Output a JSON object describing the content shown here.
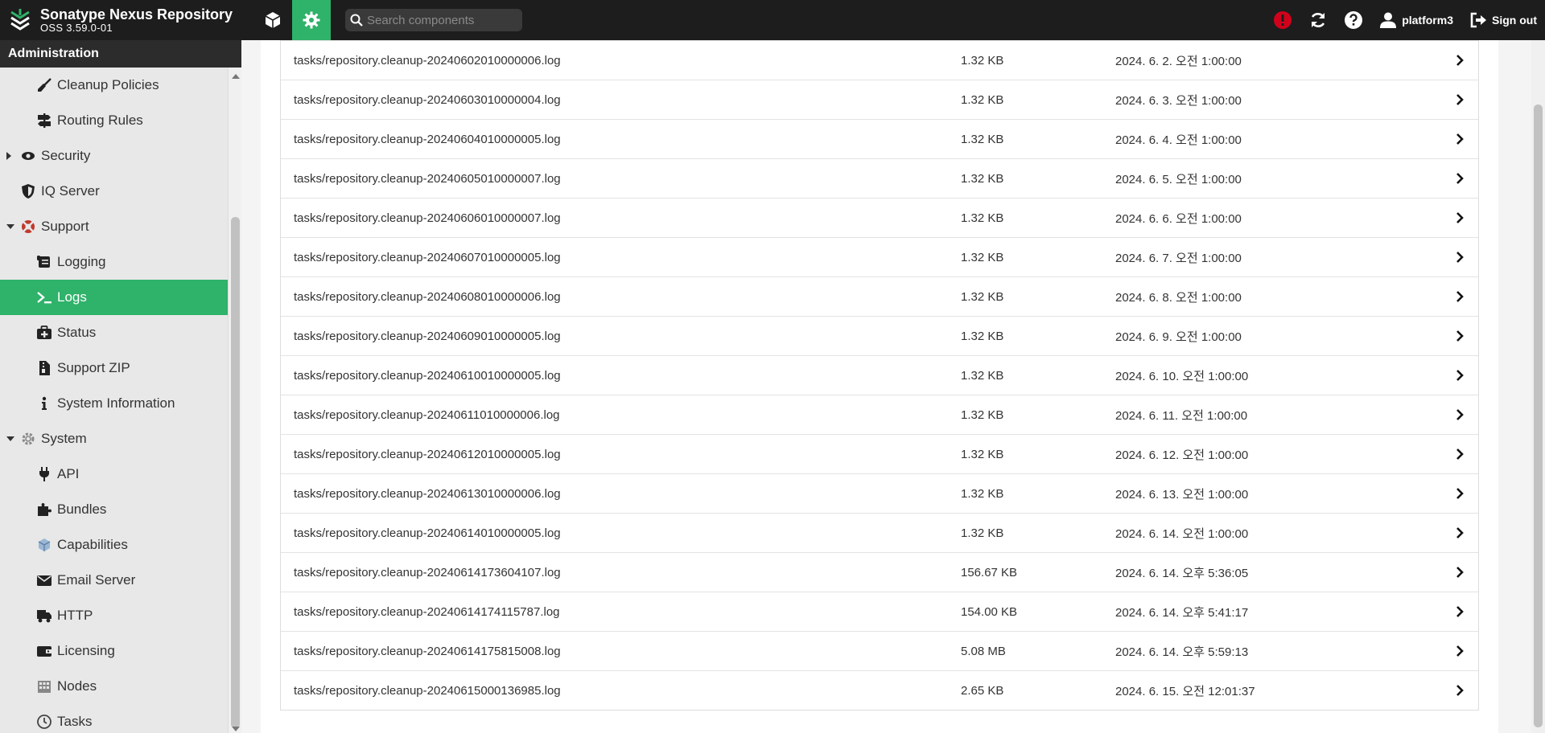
{
  "app": {
    "name": "Sonatype Nexus Repository",
    "version": "OSS 3.59.0-01"
  },
  "header": {
    "search_placeholder": "Search components",
    "user_label": "platform3",
    "signout_label": "Sign out"
  },
  "sidebar": {
    "title": "Administration",
    "items": [
      {
        "label": "Cleanup Policies",
        "icon": "broom-icon",
        "level": 2
      },
      {
        "label": "Routing Rules",
        "icon": "signpost-icon",
        "level": 2
      },
      {
        "label": "Security",
        "icon": "eye-icon",
        "level": 1,
        "caret": "right"
      },
      {
        "label": "IQ Server",
        "icon": "shield-icon",
        "level": 1
      },
      {
        "label": "Support",
        "icon": "lifebuoy-icon",
        "level": 1,
        "caret": "down"
      },
      {
        "label": "Logging",
        "icon": "scroll-icon",
        "level": 2
      },
      {
        "label": "Logs",
        "icon": "terminal-icon",
        "level": 2,
        "selected": true
      },
      {
        "label": "Status",
        "icon": "medkit-icon",
        "level": 2
      },
      {
        "label": "Support ZIP",
        "icon": "zip-file-icon",
        "level": 2
      },
      {
        "label": "System Information",
        "icon": "info-icon",
        "level": 2
      },
      {
        "label": "System",
        "icon": "gears-icon",
        "level": 1,
        "caret": "down"
      },
      {
        "label": "API",
        "icon": "plug-icon",
        "level": 2
      },
      {
        "label": "Bundles",
        "icon": "puzzle-icon",
        "level": 2
      },
      {
        "label": "Capabilities",
        "icon": "cube-icon",
        "level": 2
      },
      {
        "label": "Email Server",
        "icon": "envelope-icon",
        "level": 2
      },
      {
        "label": "HTTP",
        "icon": "truck-icon",
        "level": 2
      },
      {
        "label": "Licensing",
        "icon": "wallet-icon",
        "level": 2
      },
      {
        "label": "Nodes",
        "icon": "building-icon",
        "level": 2
      },
      {
        "label": "Tasks",
        "icon": "clock-icon",
        "level": 2
      }
    ]
  },
  "logs": [
    {
      "name": "tasks/repository.cleanup-20240602010000006.log",
      "size": "1.32 KB",
      "date": "2024. 6. 2. 오전 1:00:00"
    },
    {
      "name": "tasks/repository.cleanup-20240603010000004.log",
      "size": "1.32 KB",
      "date": "2024. 6. 3. 오전 1:00:00"
    },
    {
      "name": "tasks/repository.cleanup-20240604010000005.log",
      "size": "1.32 KB",
      "date": "2024. 6. 4. 오전 1:00:00"
    },
    {
      "name": "tasks/repository.cleanup-20240605010000007.log",
      "size": "1.32 KB",
      "date": "2024. 6. 5. 오전 1:00:00"
    },
    {
      "name": "tasks/repository.cleanup-20240606010000007.log",
      "size": "1.32 KB",
      "date": "2024. 6. 6. 오전 1:00:00"
    },
    {
      "name": "tasks/repository.cleanup-20240607010000005.log",
      "size": "1.32 KB",
      "date": "2024. 6. 7. 오전 1:00:00"
    },
    {
      "name": "tasks/repository.cleanup-20240608010000006.log",
      "size": "1.32 KB",
      "date": "2024. 6. 8. 오전 1:00:00"
    },
    {
      "name": "tasks/repository.cleanup-20240609010000005.log",
      "size": "1.32 KB",
      "date": "2024. 6. 9. 오전 1:00:00"
    },
    {
      "name": "tasks/repository.cleanup-20240610010000005.log",
      "size": "1.32 KB",
      "date": "2024. 6. 10. 오전 1:00:00"
    },
    {
      "name": "tasks/repository.cleanup-20240611010000006.log",
      "size": "1.32 KB",
      "date": "2024. 6. 11. 오전 1:00:00"
    },
    {
      "name": "tasks/repository.cleanup-20240612010000005.log",
      "size": "1.32 KB",
      "date": "2024. 6. 12. 오전 1:00:00"
    },
    {
      "name": "tasks/repository.cleanup-20240613010000006.log",
      "size": "1.32 KB",
      "date": "2024. 6. 13. 오전 1:00:00"
    },
    {
      "name": "tasks/repository.cleanup-20240614010000005.log",
      "size": "1.32 KB",
      "date": "2024. 6. 14. 오전 1:00:00"
    },
    {
      "name": "tasks/repository.cleanup-20240614173604107.log",
      "size": "156.67 KB",
      "date": "2024. 6. 14. 오후 5:36:05"
    },
    {
      "name": "tasks/repository.cleanup-20240614174115787.log",
      "size": "154.00 KB",
      "date": "2024. 6. 14. 오후 5:41:17"
    },
    {
      "name": "tasks/repository.cleanup-20240614175815008.log",
      "size": "5.08 MB",
      "date": "2024. 6. 14. 오후 5:59:13"
    },
    {
      "name": "tasks/repository.cleanup-20240615000136985.log",
      "size": "2.65 KB",
      "date": "2024. 6. 15. 오전 12:01:37"
    }
  ],
  "colors": {
    "accent": "#2fb26a",
    "header_bg": "#1d1d1d",
    "alert": "#d0021b"
  }
}
